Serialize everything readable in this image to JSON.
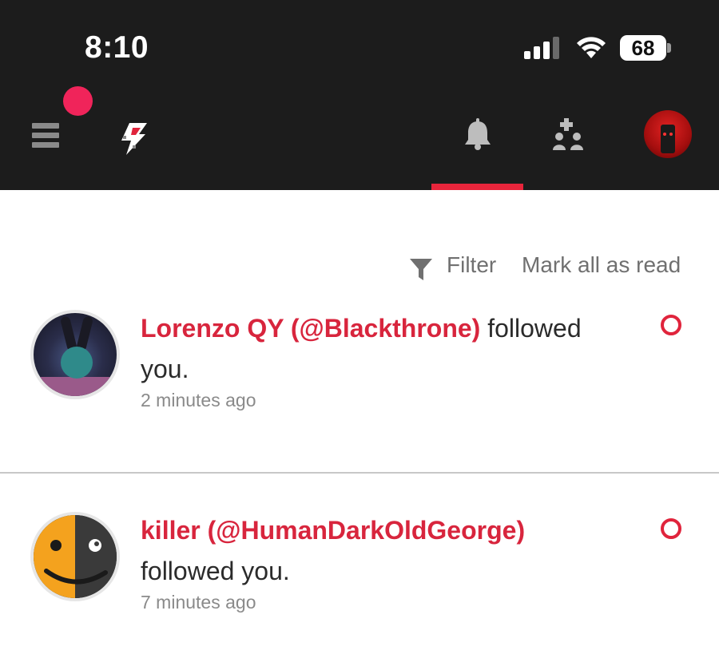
{
  "status_bar": {
    "time": "8:10",
    "battery_level": "68",
    "icons": [
      "signal-icon",
      "wifi-icon",
      "battery-icon"
    ]
  },
  "header": {
    "icons": [
      "menu-icon",
      "logo-icon",
      "bell-icon",
      "follow-requests-icon",
      "profile-avatar"
    ],
    "active_tab": "bell-icon",
    "colors": {
      "background": "#1c1c1c",
      "accent": "#e8253b",
      "notif_dot": "#f0245a"
    }
  },
  "toolbar": {
    "filter_label": "Filter",
    "mark_all_label": "Mark all as read"
  },
  "notifications": [
    {
      "name": "Lorenzo QY (@Blackthrone)",
      "action": " followed you.",
      "time": "2 minutes ago",
      "unread": true
    },
    {
      "name": "killer (@HumanDarkOldGeorge)",
      "action": " followed you.",
      "time": "7 minutes ago",
      "unread": true
    }
  ]
}
